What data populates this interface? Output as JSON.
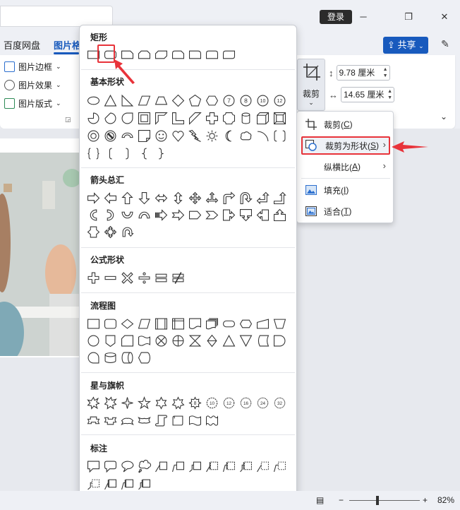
{
  "titlebar": {
    "login_label": "登录",
    "minimize_icon": "minimize-icon",
    "restore_icon": "restore-icon",
    "close_icon": "close-icon"
  },
  "tabs": {
    "items": [
      {
        "label": "百度网盘",
        "active": false
      },
      {
        "label": "图片格",
        "active": true
      }
    ],
    "share_label": "共享",
    "accent_color": "#185abd"
  },
  "ribbon": {
    "picture_border": "图片边框",
    "picture_effects": "图片效果",
    "picture_layout": "图片版式",
    "crop_label": "裁剪",
    "height_value": "9.78 厘米",
    "width_value": "14.65 厘米"
  },
  "crop_menu": {
    "items": [
      {
        "label": "裁剪(",
        "key": "C",
        "suffix": ")",
        "icon": "crop-icon",
        "submenu": false,
        "highlighted": false
      },
      {
        "label": "裁剪为形状(",
        "key": "S",
        "suffix": ")",
        "icon": "shape-crop-icon",
        "submenu": true,
        "highlighted": true
      },
      {
        "label": "纵横比(",
        "key": "A",
        "suffix": ")",
        "icon": "",
        "submenu": true,
        "highlighted": false
      },
      {
        "label": "填充(",
        "key": "I",
        "suffix": ")",
        "icon": "fill-image-icon",
        "submenu": false,
        "highlighted": false
      },
      {
        "label": "适合(",
        "key": "T",
        "suffix": ")",
        "icon": "fit-image-icon",
        "submenu": false,
        "highlighted": false
      }
    ],
    "highlight_color": "#e8333a"
  },
  "gallery": {
    "categories": {
      "rect": "矩形",
      "basic": "基本形状",
      "arrows": "箭头总汇",
      "equation": "公式形状",
      "flowchart": "流程图",
      "stars": "星与旗帜",
      "callouts": "标注"
    },
    "octagon_labels": [
      "7",
      "8",
      "10",
      "12"
    ],
    "selected_shape": "rounded-rectangle"
  },
  "statusbar": {
    "zoom_minus": "−",
    "zoom_plus": "+",
    "zoom_level": "82%",
    "zoom_fraction": 0.38
  }
}
